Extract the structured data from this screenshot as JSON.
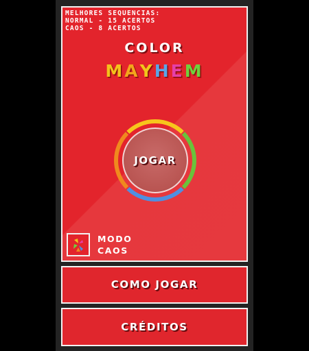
{
  "records": {
    "heading": "MELHORES SEQUENCIAS:",
    "normal": "NORMAL - 15 ACERTOS",
    "chaos": "CAOS - 8 ACERTOS"
  },
  "title": {
    "top": "COLOR",
    "letters": [
      {
        "char": "M",
        "color": "#f4c21b"
      },
      {
        "char": "A",
        "color": "#f4a51c"
      },
      {
        "char": "Y",
        "color": "#f2c51a"
      },
      {
        "char": "H",
        "color": "#5aa5e8"
      },
      {
        "char": "E",
        "color": "#e63fa8"
      },
      {
        "char": "M",
        "color": "#6fd13c"
      }
    ]
  },
  "play": {
    "label": "JOGAR"
  },
  "ring": {
    "colors": [
      "#f7c51c",
      "#6ac23b",
      "#4f8fe0",
      "#f0891e"
    ]
  },
  "chaos_mode": {
    "line1": "MODO",
    "line2": "CAOS",
    "icon": "chaos-triangle-icon"
  },
  "menu": {
    "how_to_play": "COMO JOGAR",
    "credits": "CRÉDITOS"
  }
}
